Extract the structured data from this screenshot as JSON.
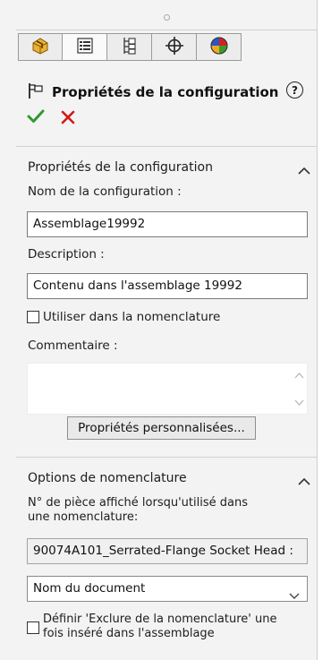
{
  "header": {
    "title": "Propriétés de la configuration",
    "help_label": "?"
  },
  "tabs": [
    {
      "name": "featuremanager",
      "icon": "feature-tree-icon"
    },
    {
      "name": "propertymanager",
      "icon": "property-manager-icon"
    },
    {
      "name": "configurationmanager",
      "icon": "configuration-manager-icon"
    },
    {
      "name": "dimxpertmanager",
      "icon": "crosshair-icon"
    },
    {
      "name": "displaymanager",
      "icon": "appearance-ball-icon"
    }
  ],
  "section1": {
    "title": "Propriétés de la configuration",
    "config_name_label": "Nom de la configuration :",
    "config_name_value": "Assemblage19992",
    "description_label": "Description :",
    "description_value": "Contenu dans l'assemblage 19992",
    "bom_checkbox_label": "Utiliser dans la nomenclature",
    "bom_checkbox_checked": false,
    "comment_label": "Commentaire :",
    "comment_value": "",
    "custom_props_button": "Propriétés personnalisées..."
  },
  "section2": {
    "title": "Options de nomenclature",
    "part_number_label_line1": "N° de pièce affiché lorsqu'utilisé dans",
    "part_number_label_line2": "une nomenclature:",
    "part_number_value": "90074A101_Serrated-Flange Socket Head :",
    "source_select_value": "Nom du document",
    "exclude_label_line1": "Définir 'Exclure de la nomenclature' une",
    "exclude_label_line2": "fois inséré dans l'assemblage",
    "exclude_checked": false
  },
  "colors": {
    "panel_bg": "#f3f3f3",
    "ok_green": "#2e9a2e",
    "cancel_red": "#d11a1a"
  }
}
